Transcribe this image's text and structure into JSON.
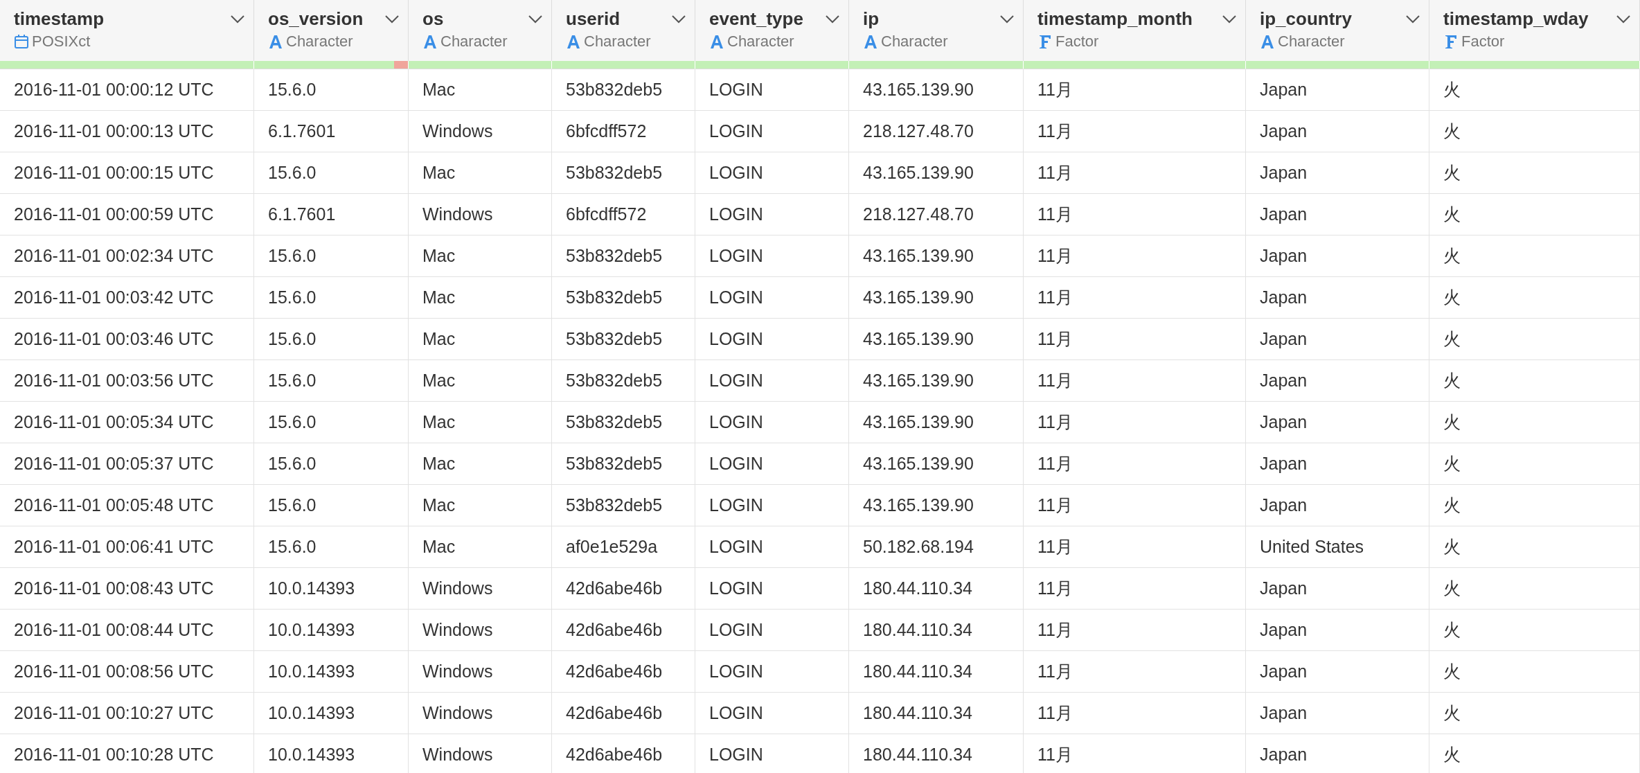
{
  "table": {
    "columns": [
      {
        "name": "timestamp",
        "type": "POSIXct",
        "kind": "datetime",
        "level": 1
      },
      {
        "name": "os_version",
        "type": "Character",
        "kind": "character",
        "level": 0.91
      },
      {
        "name": "os",
        "type": "Character",
        "kind": "character",
        "level": 1
      },
      {
        "name": "userid",
        "type": "Character",
        "kind": "character",
        "level": 1
      },
      {
        "name": "event_type",
        "type": "Character",
        "kind": "character",
        "level": 1
      },
      {
        "name": "ip",
        "type": "Character",
        "kind": "character",
        "level": 1
      },
      {
        "name": "timestamp_month",
        "type": "Factor",
        "kind": "factor",
        "level": 1
      },
      {
        "name": "ip_country",
        "type": "Character",
        "kind": "character",
        "level": 1
      },
      {
        "name": "timestamp_wday",
        "type": "Factor",
        "kind": "factor",
        "level": 1
      }
    ],
    "rows": [
      [
        "2016-11-01 00:00:12 UTC",
        "15.6.0",
        "Mac",
        "53b832deb5",
        "LOGIN",
        "43.165.139.90",
        "11月",
        "Japan",
        "火"
      ],
      [
        "2016-11-01 00:00:13 UTC",
        "6.1.7601",
        "Windows",
        "6bfcdff572",
        "LOGIN",
        "218.127.48.70",
        "11月",
        "Japan",
        "火"
      ],
      [
        "2016-11-01 00:00:15 UTC",
        "15.6.0",
        "Mac",
        "53b832deb5",
        "LOGIN",
        "43.165.139.90",
        "11月",
        "Japan",
        "火"
      ],
      [
        "2016-11-01 00:00:59 UTC",
        "6.1.7601",
        "Windows",
        "6bfcdff572",
        "LOGIN",
        "218.127.48.70",
        "11月",
        "Japan",
        "火"
      ],
      [
        "2016-11-01 00:02:34 UTC",
        "15.6.0",
        "Mac",
        "53b832deb5",
        "LOGIN",
        "43.165.139.90",
        "11月",
        "Japan",
        "火"
      ],
      [
        "2016-11-01 00:03:42 UTC",
        "15.6.0",
        "Mac",
        "53b832deb5",
        "LOGIN",
        "43.165.139.90",
        "11月",
        "Japan",
        "火"
      ],
      [
        "2016-11-01 00:03:46 UTC",
        "15.6.0",
        "Mac",
        "53b832deb5",
        "LOGIN",
        "43.165.139.90",
        "11月",
        "Japan",
        "火"
      ],
      [
        "2016-11-01 00:03:56 UTC",
        "15.6.0",
        "Mac",
        "53b832deb5",
        "LOGIN",
        "43.165.139.90",
        "11月",
        "Japan",
        "火"
      ],
      [
        "2016-11-01 00:05:34 UTC",
        "15.6.0",
        "Mac",
        "53b832deb5",
        "LOGIN",
        "43.165.139.90",
        "11月",
        "Japan",
        "火"
      ],
      [
        "2016-11-01 00:05:37 UTC",
        "15.6.0",
        "Mac",
        "53b832deb5",
        "LOGIN",
        "43.165.139.90",
        "11月",
        "Japan",
        "火"
      ],
      [
        "2016-11-01 00:05:48 UTC",
        "15.6.0",
        "Mac",
        "53b832deb5",
        "LOGIN",
        "43.165.139.90",
        "11月",
        "Japan",
        "火"
      ],
      [
        "2016-11-01 00:06:41 UTC",
        "15.6.0",
        "Mac",
        "af0e1e529a",
        "LOGIN",
        "50.182.68.194",
        "11月",
        "United States",
        "火"
      ],
      [
        "2016-11-01 00:08:43 UTC",
        "10.0.14393",
        "Windows",
        "42d6abe46b",
        "LOGIN",
        "180.44.110.34",
        "11月",
        "Japan",
        "火"
      ],
      [
        "2016-11-01 00:08:44 UTC",
        "10.0.14393",
        "Windows",
        "42d6abe46b",
        "LOGIN",
        "180.44.110.34",
        "11月",
        "Japan",
        "火"
      ],
      [
        "2016-11-01 00:08:56 UTC",
        "10.0.14393",
        "Windows",
        "42d6abe46b",
        "LOGIN",
        "180.44.110.34",
        "11月",
        "Japan",
        "火"
      ],
      [
        "2016-11-01 00:10:27 UTC",
        "10.0.14393",
        "Windows",
        "42d6abe46b",
        "LOGIN",
        "180.44.110.34",
        "11月",
        "Japan",
        "火"
      ],
      [
        "2016-11-01 00:10:28 UTC",
        "10.0.14393",
        "Windows",
        "42d6abe46b",
        "LOGIN",
        "180.44.110.34",
        "11月",
        "Japan",
        "火"
      ]
    ]
  }
}
